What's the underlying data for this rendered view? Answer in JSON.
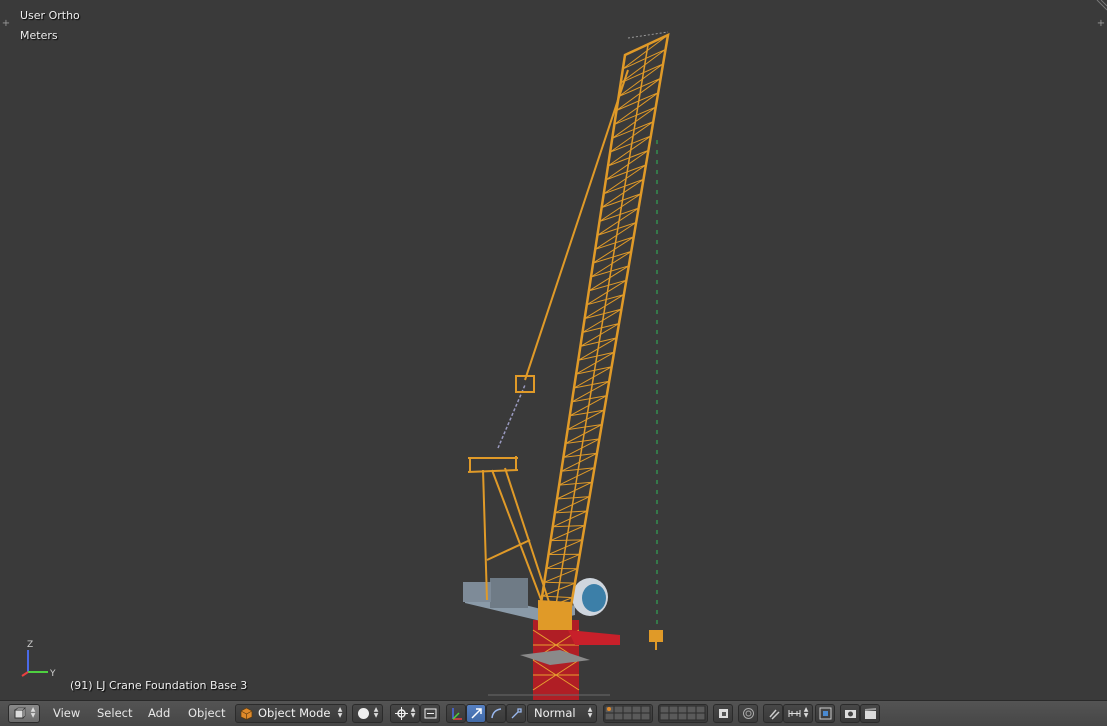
{
  "viewport": {
    "view_name": "User Ortho",
    "units": "Meters",
    "object_info": "(91) LJ Crane Foundation Base 3",
    "axes": {
      "z": "Z",
      "y": "Y"
    }
  },
  "header": {
    "menus": [
      "View",
      "Select",
      "Add",
      "Object"
    ],
    "mode": "Object Mode",
    "transform_orientation": "Normal"
  },
  "colors": {
    "viewport_bg": "#3a3a3a",
    "crane_boom": "#e09a28",
    "crane_tower": "#c8202a",
    "accent_blue": "#5680c2"
  }
}
